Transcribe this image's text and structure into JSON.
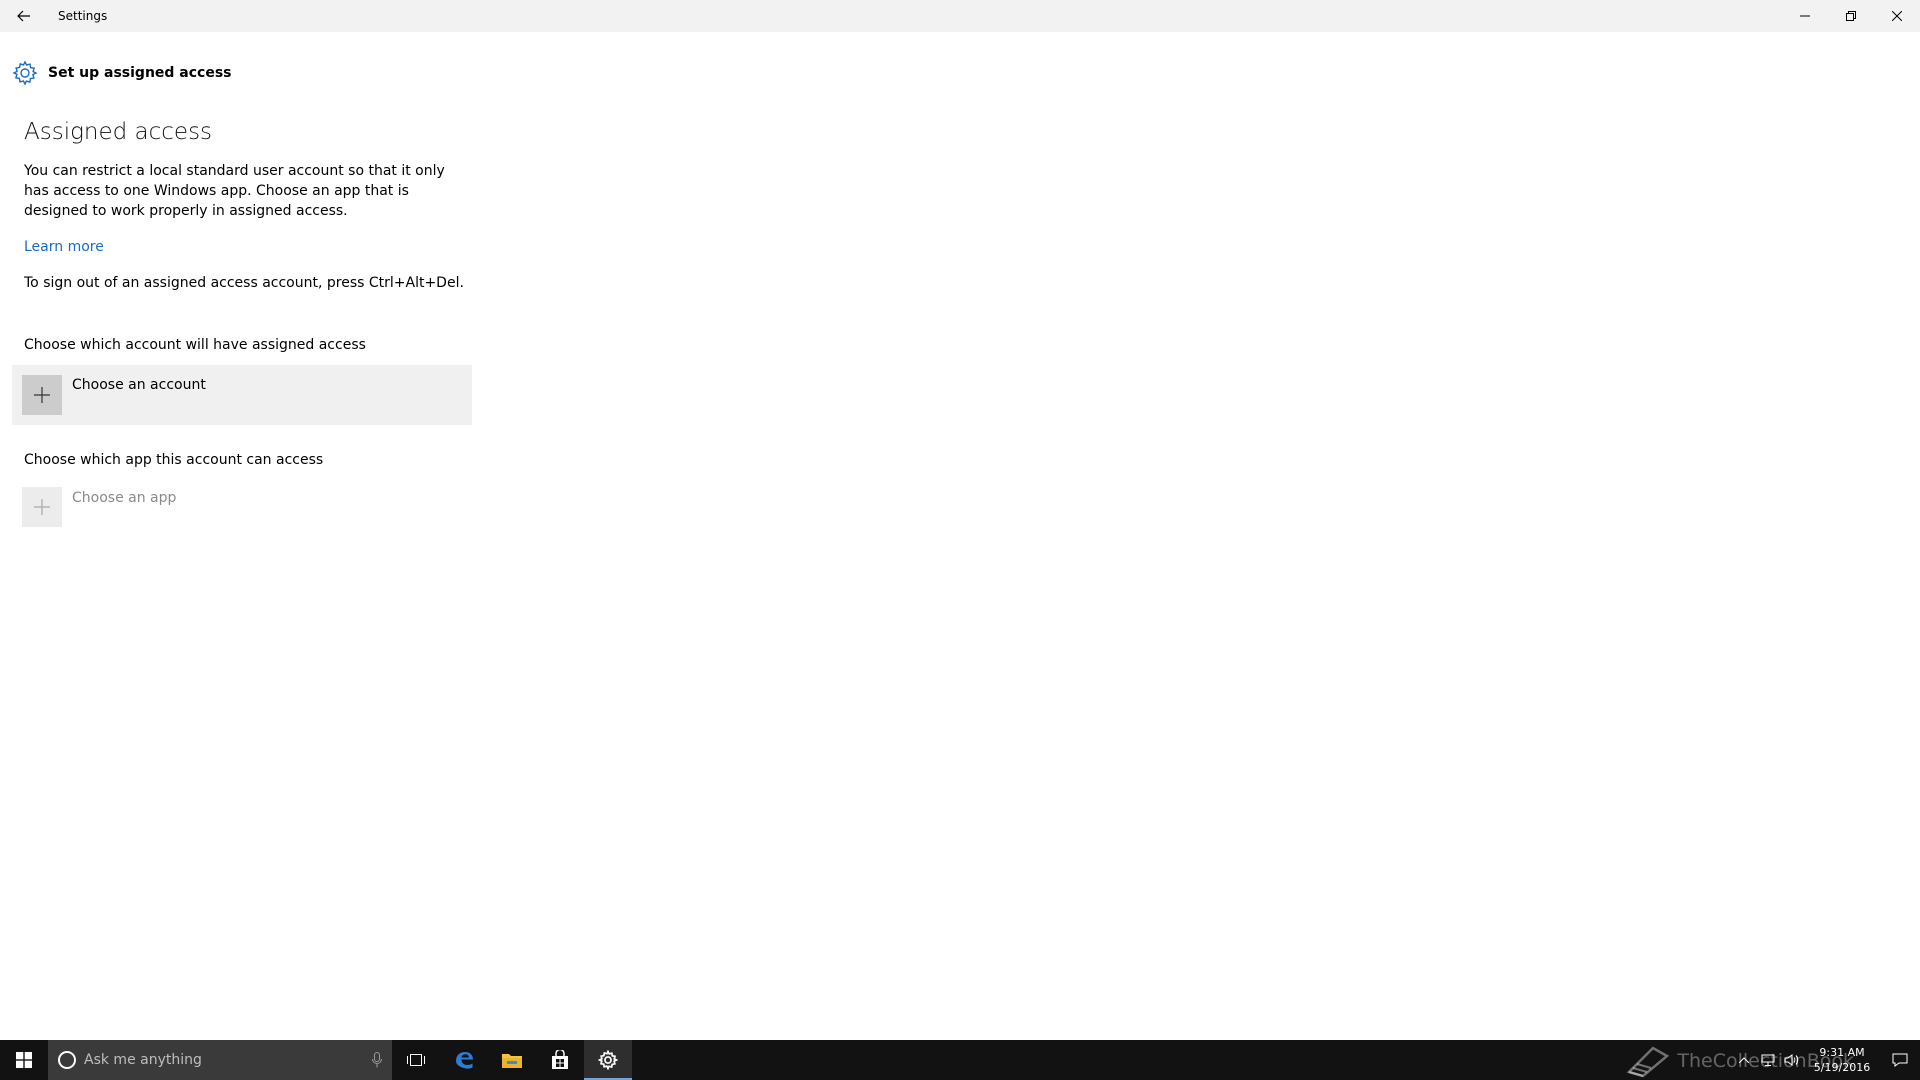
{
  "window": {
    "title": "Settings"
  },
  "page": {
    "header": "Set up assigned access",
    "heading": "Assigned access",
    "description": "You can restrict a local standard user account so that it only has access to one Windows app. Choose an app that is designed to work properly in assigned access.",
    "learn_more": "Learn more",
    "signout_note": "To sign out of an assigned access account, press Ctrl+Alt+Del.",
    "account_label": "Choose which account will have assigned access",
    "account_button": "Choose an account",
    "app_label": "Choose which app this account can access",
    "app_button": "Choose an app"
  },
  "taskbar": {
    "search_placeholder": "Ask me anything",
    "apps": [
      "task-view",
      "edge",
      "file-explorer",
      "store",
      "settings"
    ],
    "active_app": "settings",
    "clock_time": "9:31 AM",
    "clock_date": "5/19/2016",
    "watermark": "TheCollectionBook"
  },
  "colors": {
    "accent": "#1a6bbf",
    "titlebar": "#f2f2f2",
    "taskbar": "#121212",
    "picker_bg": "#f0f0f0"
  }
}
